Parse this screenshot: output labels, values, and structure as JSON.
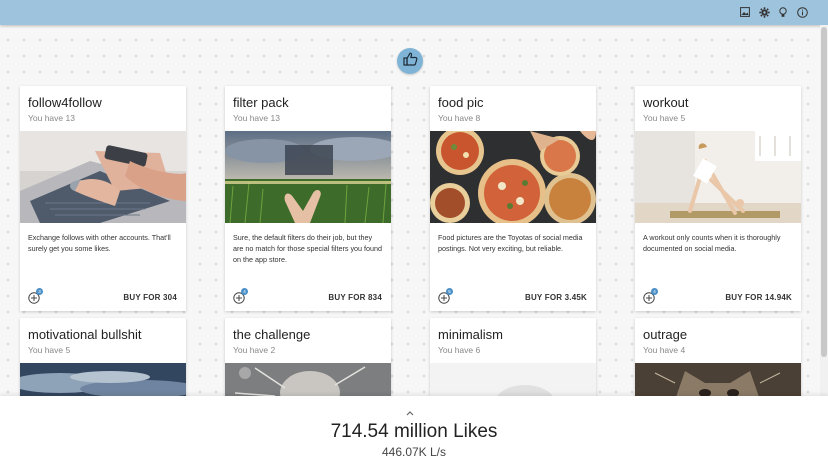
{
  "colors": {
    "topbar": "#9ec4dd",
    "accent": "#7fb4d6",
    "badge": "#4a90c8"
  },
  "topbar": {
    "icons": [
      "image-icon",
      "settings-gear-icon",
      "lightbulb-icon",
      "info-icon"
    ]
  },
  "like_button": {
    "icon": "thumbs-up-icon"
  },
  "cards": [
    {
      "title": "follow4follow",
      "owned": "You have 13",
      "desc": "Exchange follows with other accounts. That'll surely get you some likes.",
      "badge": "3",
      "buy": "BUY FOR 304",
      "image": "laptop-phone-photo"
    },
    {
      "title": "filter pack",
      "owned": "You have 13",
      "desc": "Sure, the default filters do their job, but they are no match for those special filters you found on the app store.",
      "badge": "4",
      "buy": "BUY FOR 834",
      "image": "field-sunset-photo"
    },
    {
      "title": "food pic",
      "owned": "You have 8",
      "desc": "Food pictures are the Toyotas of social media postings. Not very exciting, but reliable.",
      "badge": "5",
      "buy": "BUY FOR 3.45K",
      "image": "pizza-table-photo"
    },
    {
      "title": "workout",
      "owned": "You have 5",
      "desc": "A workout only counts when it is thoroughly documented on social media.",
      "badge": "4",
      "buy": "BUY FOR 14.94K",
      "image": "yoga-pose-photo"
    },
    {
      "title": "motivational bullshit",
      "owned": "You have 5",
      "image": "sky-clouds-photo"
    },
    {
      "title": "the challenge",
      "owned": "You have 2",
      "image": "splash-photo"
    },
    {
      "title": "minimalism",
      "owned": "You have 6",
      "image": "minimal-photo"
    },
    {
      "title": "outrage",
      "owned": "You have 4",
      "image": "cat-photo"
    }
  ],
  "footer": {
    "likes": "714.54 million Likes",
    "rate": "446.07K L/s"
  }
}
